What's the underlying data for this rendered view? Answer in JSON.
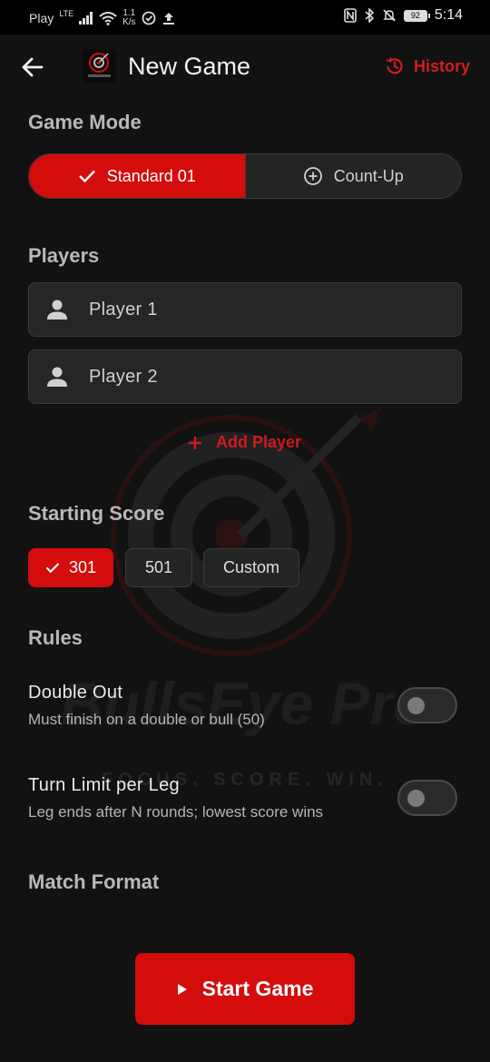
{
  "status_bar": {
    "carrier": "Play",
    "network": "LTE",
    "speed_value": "1.1",
    "speed_unit": "K/s",
    "battery": "92",
    "time": "5:14"
  },
  "header": {
    "title": "New Game",
    "history_label": "History"
  },
  "game_mode": {
    "title": "Game Mode",
    "options": [
      {
        "label": "Standard 01",
        "selected": true
      },
      {
        "label": "Count-Up",
        "selected": false
      }
    ]
  },
  "players": {
    "title": "Players",
    "list": [
      {
        "name": "Player 1"
      },
      {
        "name": "Player 2"
      }
    ],
    "add_label": "Add Player"
  },
  "starting_score": {
    "title": "Starting Score",
    "options": [
      {
        "label": "301",
        "selected": true
      },
      {
        "label": "501",
        "selected": false
      },
      {
        "label": "Custom",
        "selected": false
      }
    ]
  },
  "rules": {
    "title": "Rules",
    "items": [
      {
        "title": "Double Out",
        "description": "Must finish on a double or bull (50)",
        "enabled": false
      },
      {
        "title": "Turn Limit per Leg",
        "description": "Leg ends after N rounds; lowest score wins",
        "enabled": false
      }
    ]
  },
  "match_format": {
    "title": "Match Format"
  },
  "watermark": {
    "brand": "BullsEye Pro",
    "tagline": "FOCUS. SCORE. WIN."
  },
  "start_button": {
    "label": "Start Game"
  },
  "colors": {
    "accent": "#d40c0c",
    "background": "#121212"
  }
}
